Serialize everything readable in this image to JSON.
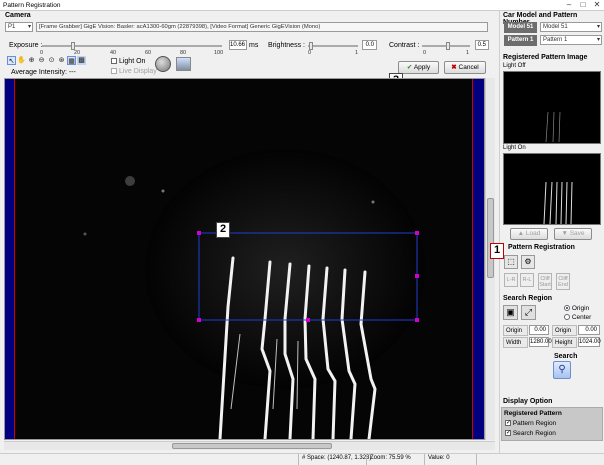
{
  "window": {
    "title": "Pattern Registration"
  },
  "camera": {
    "section": "Camera",
    "port": "P1",
    "info": "[Frame Grabber] GigE Vision: Basler: acA1300-60gm (22879398),    [Video Format] Generic GigEVision (Mono)"
  },
  "exposure": {
    "label": "Exposure :",
    "ticks": [
      "0",
      "20",
      "40",
      "60",
      "80",
      "100"
    ],
    "value": "10.66",
    "unit": "ms"
  },
  "brightness": {
    "label": "Brightness :",
    "ticks": [
      "0",
      "1"
    ],
    "value": "0.0"
  },
  "contrast": {
    "label": "Contrast :",
    "ticks": [
      "0",
      "1"
    ],
    "value": "0.5"
  },
  "toolbar": {
    "light_on": "Light On",
    "live_display": "Live Display",
    "avg_intensity": "Average Intensity:   ---"
  },
  "actions": {
    "apply": "Apply",
    "cancel": "Cancel"
  },
  "callouts": [
    "1",
    "2",
    "3"
  ],
  "right": {
    "car_model_title": "Car Model and Pattern Number",
    "model_btn": "Model 51",
    "model_value": "Model 51",
    "pattern_btn": "Pattern 1",
    "pattern_value": "Pattern 1",
    "registered_title": "Registered Pattern Image",
    "light_off": "Light Off",
    "light_on": "Light On",
    "load": "Load",
    "save": "Save",
    "pattern_reg_title": "Pattern Registration",
    "lr": "L-R",
    "rl": "R-L",
    "cliff_start": "Cliff Start",
    "cliff_end": "Cliff End",
    "search_region_title": "Search Region",
    "origin": "Origin",
    "center": "Center",
    "origin_x_label": "Origin X",
    "origin_x": "0.00",
    "origin_y_label": "Origin Y",
    "origin_y": "0.00",
    "width_label": "Width",
    "width": "1280.00",
    "height_label": "Height",
    "height": "1024.00",
    "search_title": "Search",
    "display_option_title": "Display Option",
    "registered_pattern": "Registered Pattern",
    "pattern_region": "Pattern Region",
    "search_region": "Search Region"
  },
  "status": {
    "space": "# Space: (1240.87, 1.323)",
    "zoom": "Zoom: 75.59 %",
    "value": "Value: 0"
  },
  "colors": {
    "accent_red": "#c00000",
    "roi_blue": "#1f3fd0",
    "handle": "#d000d0",
    "bar_blue": "#000080"
  }
}
